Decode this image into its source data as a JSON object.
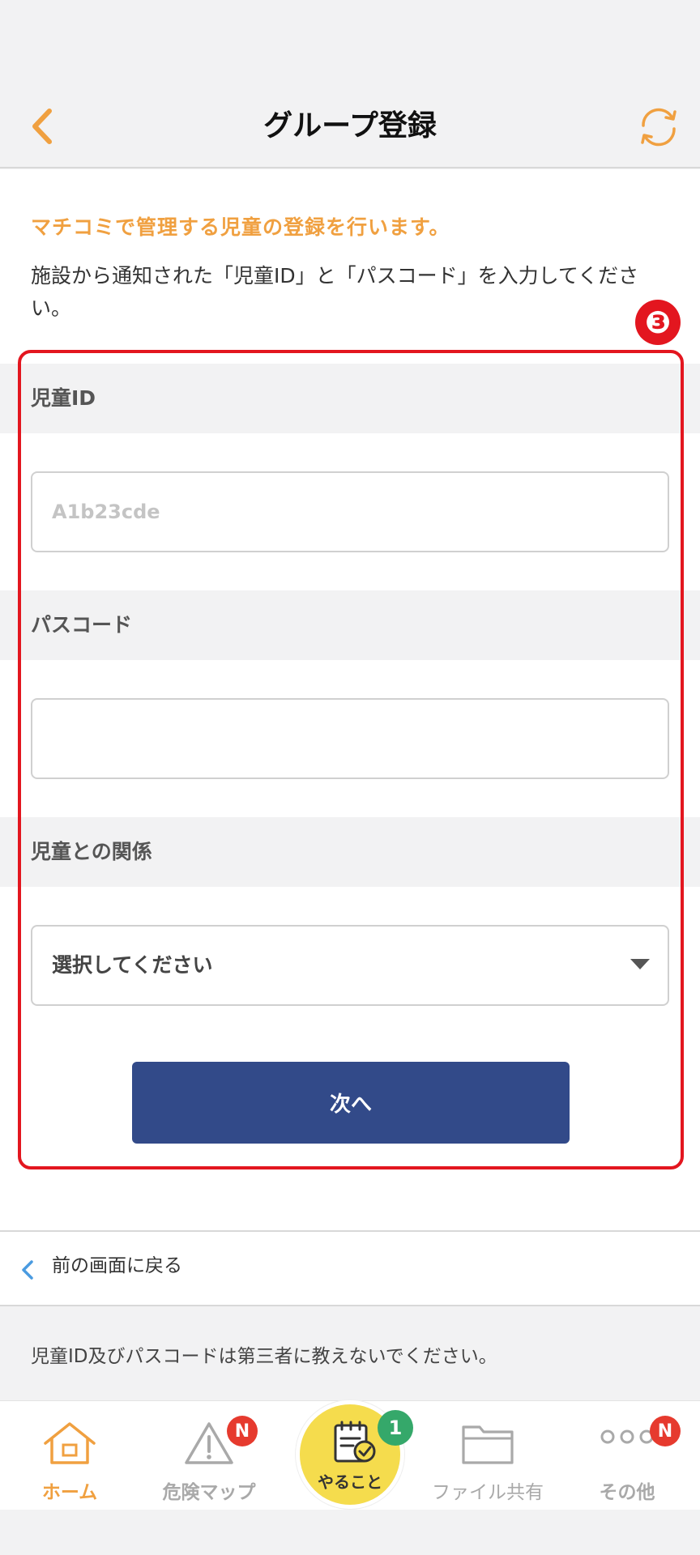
{
  "header": {
    "title": "グループ登録"
  },
  "intro": {
    "accent": "マチコミで管理する児童の登録を行います。",
    "text": "施設から通知された「児童ID」と「パスコード」を入力してください。"
  },
  "annotation": {
    "marker": "❸",
    "color": "#e3161f"
  },
  "form": {
    "child_id": {
      "label": "児童ID",
      "placeholder": "A1b23cde",
      "value": ""
    },
    "passcode": {
      "label": "パスコード",
      "value": ""
    },
    "relation": {
      "label": "児童との関係",
      "selected": "選択してください"
    },
    "next_label": "次へ"
  },
  "back_link": {
    "label": "前の画面に戻る"
  },
  "notice": "児童ID及びパスコードは第三者に教えないでください。",
  "tabbar": {
    "items": [
      {
        "label": "ホーム",
        "icon": "home-icon",
        "active": true
      },
      {
        "label": "危険マップ",
        "icon": "warning-icon",
        "badge": "N"
      },
      {
        "label": "やること",
        "icon": "task-icon",
        "badge": "1"
      },
      {
        "label": "ファイル共有",
        "icon": "folder-icon"
      },
      {
        "label": "その他",
        "icon": "more-icon",
        "badge": "N"
      }
    ]
  },
  "colors": {
    "accent": "#f0a040",
    "primary_button": "#324a89",
    "badge_red": "#e63a2e",
    "badge_green": "#35a86a",
    "center_tab": "#f5dc4d"
  }
}
